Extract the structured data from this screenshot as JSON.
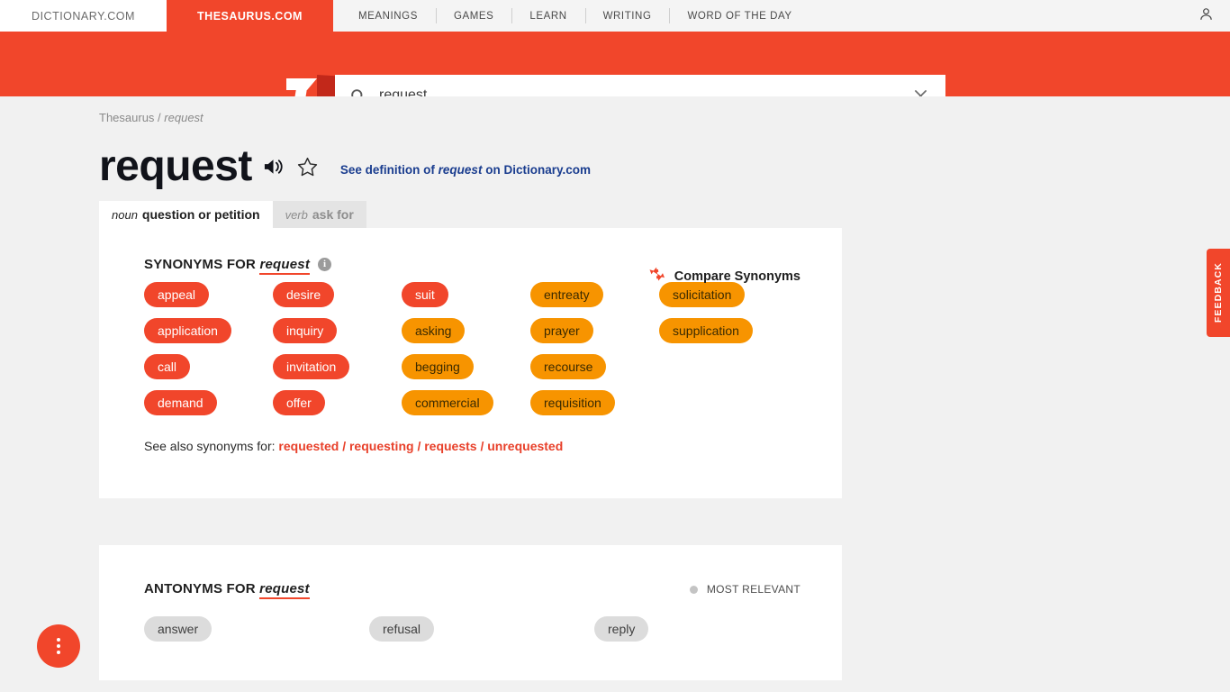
{
  "nav": {
    "sites": [
      {
        "label": "DICTIONARY.COM",
        "active": false
      },
      {
        "label": "THESAURUS.COM",
        "active": true
      }
    ],
    "links": [
      "MEANINGS",
      "GAMES",
      "LEARN",
      "WRITING",
      "WORD OF THE DAY"
    ],
    "user_icon": "user-account-icon"
  },
  "search": {
    "value": "request",
    "placeholder": "Search",
    "search_icon": "search-icon",
    "clear_icon": "close-icon",
    "logo": "thesaurus-t-logo"
  },
  "breadcrumb": {
    "root": "Thesaurus",
    "separator": "/",
    "current": "request"
  },
  "headword": {
    "word": "request",
    "audio_icon": "speaker-icon",
    "favorite_icon": "star-outline-icon",
    "definition_link": {
      "prefix": "See definition of",
      "word": "request",
      "suffix": "on Dictionary.com"
    }
  },
  "pos_tabs": [
    {
      "pos": "noun",
      "sense": "question or petition",
      "active": true
    },
    {
      "pos": "verb",
      "sense": "ask for",
      "active": false
    }
  ],
  "synonyms": {
    "heading_prefix": "SYNONYMS FOR",
    "heading_word": "request",
    "info_icon": "info-icon",
    "info_glyph": "i",
    "compare": {
      "label": "Compare Synonyms",
      "icon": "compare-arrows-icon"
    },
    "columns": [
      [
        {
          "label": "appeal",
          "level": "lvl3"
        },
        {
          "label": "application",
          "level": "lvl3"
        },
        {
          "label": "call",
          "level": "lvl3"
        },
        {
          "label": "demand",
          "level": "lvl3"
        }
      ],
      [
        {
          "label": "desire",
          "level": "lvl3"
        },
        {
          "label": "inquiry",
          "level": "lvl3"
        },
        {
          "label": "invitation",
          "level": "lvl3"
        },
        {
          "label": "offer",
          "level": "lvl3"
        }
      ],
      [
        {
          "label": "suit",
          "level": "lvl3"
        },
        {
          "label": "asking",
          "level": "lvl2"
        },
        {
          "label": "begging",
          "level": "lvl2"
        },
        {
          "label": "commercial",
          "level": "lvl2"
        }
      ],
      [
        {
          "label": "entreaty",
          "level": "lvl2"
        },
        {
          "label": "prayer",
          "level": "lvl2"
        },
        {
          "label": "recourse",
          "level": "lvl2"
        },
        {
          "label": "requisition",
          "level": "lvl2"
        }
      ],
      [
        {
          "label": "solicitation",
          "level": "lvl2"
        },
        {
          "label": "supplication",
          "level": "lvl2"
        }
      ]
    ],
    "see_also": {
      "label": "See also synonyms for:",
      "links": "requested / requesting / requests / unrequested"
    }
  },
  "antonyms": {
    "heading_prefix": "ANTONYMS FOR",
    "heading_word": "request",
    "relevance": "MOST RELEVANT",
    "columns": [
      {
        "label": "answer"
      },
      {
        "label": "refusal"
      },
      {
        "label": "reply"
      }
    ]
  },
  "feedback": {
    "label": "FEEDBACK"
  },
  "fab": {
    "name": "more-options-button"
  },
  "colors": {
    "brand_red": "#f1462b",
    "brand_red_dark": "#c2281a",
    "chip_orange": "#f79400",
    "link_blue": "#1a3d8f",
    "page_bg": "#f1f1f1"
  }
}
